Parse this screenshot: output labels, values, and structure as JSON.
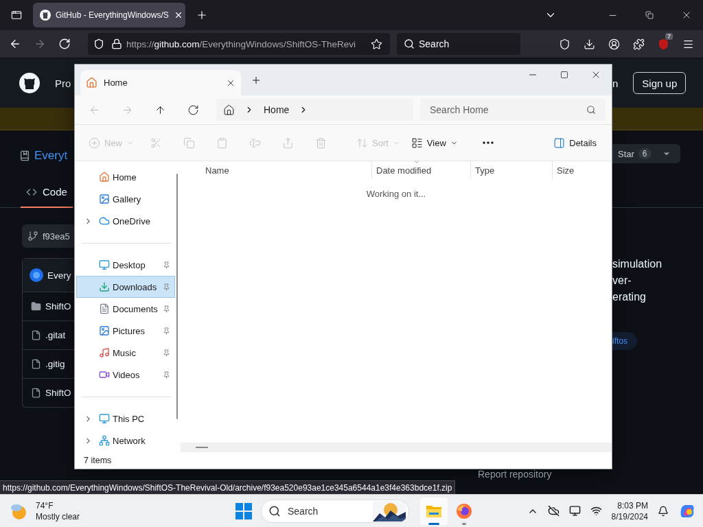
{
  "browser": {
    "tabs": [
      {
        "title": "GitHub - EverythingWindows/S",
        "selected": true
      }
    ],
    "nav": [
      {
        "kind": "back",
        "disabled": false
      },
      {
        "kind": "forward",
        "disabled": true
      },
      {
        "kind": "reload",
        "disabled": false
      }
    ],
    "url": "https://**github.com**/EverythingWindows/ShiftOS-TheRevi",
    "search_placeholder": "Search",
    "extension_badge": "7"
  },
  "github": {
    "header_left": "Pro",
    "header_right": "n",
    "sign_up": "Sign up",
    "repo": "Everyt",
    "tabs": [
      {
        "label": "Code",
        "selected": true
      }
    ],
    "branch": "f93ea5",
    "files": [
      {
        "kind": "avatar",
        "name": "Every"
      },
      {
        "kind": "folder",
        "name": "ShiftO"
      },
      {
        "kind": "file",
        "name": ".gitat"
      },
      {
        "kind": "file",
        "name": ".gitig"
      },
      {
        "kind": "file",
        "name": "ShiftO"
      }
    ],
    "star": {
      "label": "Star",
      "count": "6"
    },
    "about": [
      "simulation",
      "ver-",
      "erating"
    ],
    "topic": "iftos",
    "report": "Report repository"
  },
  "explorer": {
    "tabs": [
      {
        "title": "Home",
        "selected": true
      }
    ],
    "nav": [
      {
        "kind": "back",
        "disabled": true
      },
      {
        "kind": "forward",
        "disabled": true
      },
      {
        "kind": "up",
        "disabled": false
      },
      {
        "kind": "refresh",
        "disabled": false
      }
    ],
    "breadcrumb": [
      "Home"
    ],
    "search_placeholder": "Search Home",
    "commands": [
      {
        "kind": "new",
        "label": "New",
        "disabled": true
      },
      {
        "kind": "cut",
        "disabled": true
      },
      {
        "kind": "copy",
        "disabled": true
      },
      {
        "kind": "paste",
        "disabled": true
      },
      {
        "kind": "rename",
        "disabled": true
      },
      {
        "kind": "share",
        "disabled": true
      },
      {
        "kind": "delete",
        "disabled": true
      },
      {
        "kind": "sort",
        "label": "Sort",
        "disabled": true
      },
      {
        "kind": "view",
        "label": "View",
        "disabled": false
      },
      {
        "kind": "more",
        "disabled": false
      }
    ],
    "details": "Details",
    "nav_groups": [
      [
        {
          "label": "Home",
          "kind": "home",
          "expandable": false,
          "pinned": false,
          "selected": false
        },
        {
          "label": "Gallery",
          "kind": "gallery",
          "expandable": false,
          "pinned": false,
          "selected": false
        },
        {
          "label": "OneDrive",
          "kind": "cloud",
          "expandable": true,
          "pinned": false,
          "selected": false
        }
      ],
      [
        {
          "label": "Desktop",
          "kind": "desktop",
          "expandable": false,
          "pinned": true,
          "selected": false
        },
        {
          "label": "Downloads",
          "kind": "downloads",
          "expandable": false,
          "pinned": true,
          "selected": true
        },
        {
          "label": "Documents",
          "kind": "documents",
          "expandable": false,
          "pinned": true,
          "selected": false
        },
        {
          "label": "Pictures",
          "kind": "pictures",
          "expandable": false,
          "pinned": true,
          "selected": false
        },
        {
          "label": "Music",
          "kind": "music",
          "expandable": false,
          "pinned": true,
          "selected": false
        },
        {
          "label": "Videos",
          "kind": "videos",
          "expandable": false,
          "pinned": true,
          "selected": false
        }
      ],
      [
        {
          "label": "This PC",
          "kind": "pc",
          "expandable": true,
          "pinned": false,
          "selected": false
        },
        {
          "label": "Network",
          "kind": "network",
          "expandable": true,
          "pinned": false,
          "selected": false
        }
      ]
    ],
    "columns": [
      {
        "label": "Name",
        "sorted": false
      },
      {
        "label": "Date modified",
        "sorted": true
      },
      {
        "label": "Type",
        "sorted": false
      },
      {
        "label": "Size",
        "sorted": false
      }
    ],
    "message": "Working on it...",
    "status": "7 items"
  },
  "status_url": "https://github.com/EverythingWindows/ShiftOS-TheRevival-Old/archive/f93ea520e93ae1ce345a6544a1e3f4e363bdce1f.zip",
  "taskbar": {
    "weather": {
      "temp": "74°F",
      "condition": "Mostly clear"
    },
    "search_placeholder": "Search",
    "apps": [
      {
        "kind": "explorer",
        "active": true
      },
      {
        "kind": "firefox",
        "active": false
      }
    ],
    "time": "8:03 PM",
    "date": "8/19/2024"
  }
}
